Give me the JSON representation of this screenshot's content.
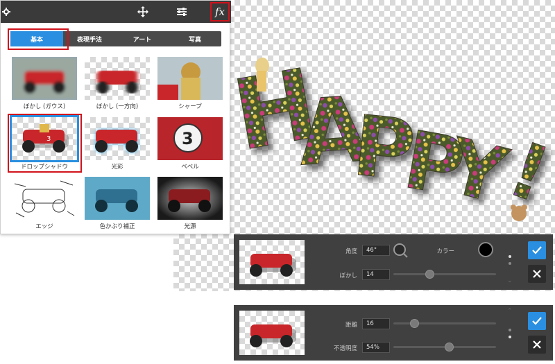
{
  "categories": [
    {
      "label": "基本",
      "active": true
    },
    {
      "label": "表現手法",
      "active": false
    },
    {
      "label": "アート",
      "active": false
    },
    {
      "label": "写真",
      "active": false
    }
  ],
  "effects": [
    {
      "label": "ぼかし (ガウス)",
      "selected": false
    },
    {
      "label": "ぼかし (一方向)",
      "selected": false
    },
    {
      "label": "シャープ",
      "selected": false
    },
    {
      "label": "ドロップシャドウ",
      "selected": true
    },
    {
      "label": "光彩",
      "selected": false
    },
    {
      "label": "ベベル",
      "selected": false
    },
    {
      "label": "エッジ",
      "selected": false
    },
    {
      "label": "色かぶり補正",
      "selected": false
    },
    {
      "label": "光源",
      "selected": false
    }
  ],
  "toolbar": {
    "fx_label": "fx"
  },
  "shadow_settings_page1": {
    "angle_label": "角度",
    "angle_value": "46°",
    "color_label": "カラー",
    "color_value": "#000000",
    "blur_label": "ぼかし",
    "blur_value": "14",
    "blur_level": 0.35
  },
  "shadow_settings_page2": {
    "distance_label": "距離",
    "distance_value": "16",
    "distance_level": 0.2,
    "opacity_label": "不透明度",
    "opacity_value": "54%",
    "opacity_level": 0.54
  },
  "colors": {
    "accent": "#2a8fe0",
    "highlight": "#d0121b",
    "panel_dark": "#404040"
  },
  "happy_text": [
    "H",
    "A",
    "P",
    "P",
    "Y",
    "!"
  ]
}
